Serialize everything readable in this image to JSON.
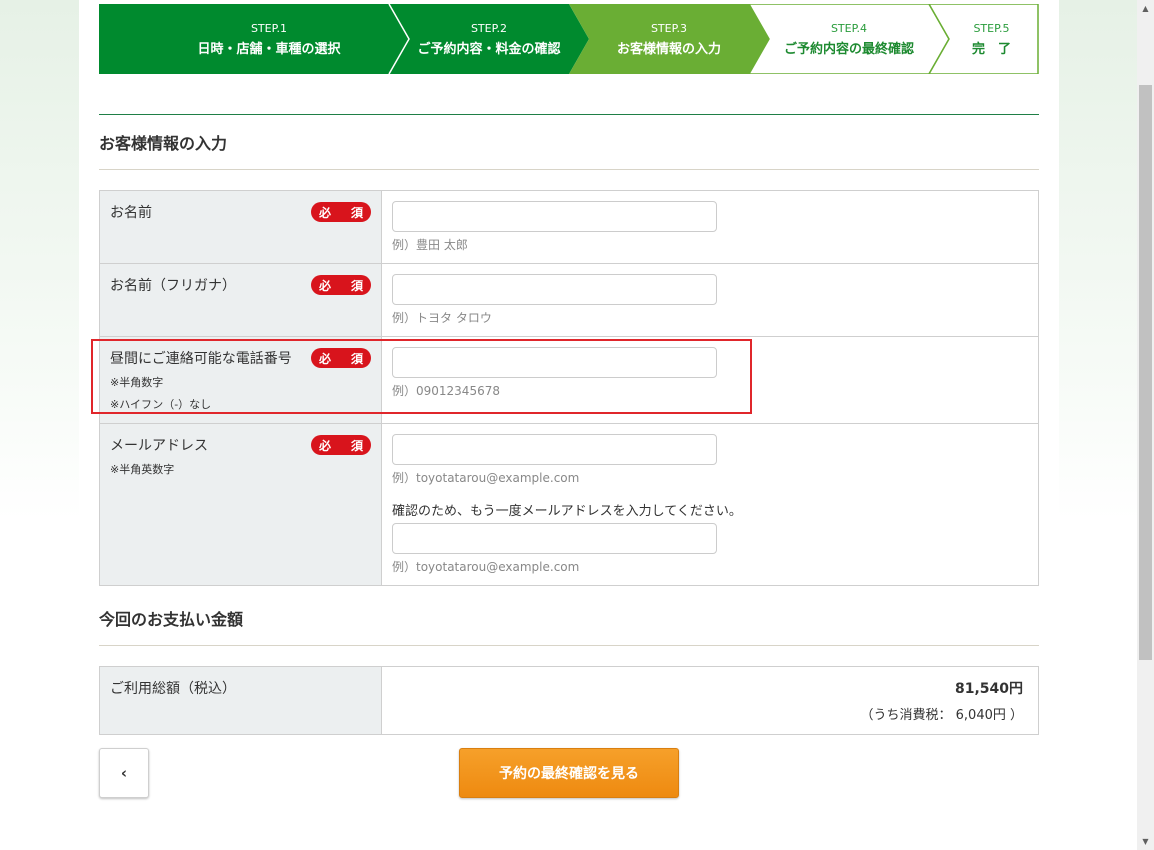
{
  "steps": [
    {
      "num": "STEP.1",
      "name": "日時・店舗・車種の選択"
    },
    {
      "num": "STEP.2",
      "name": "ご予約内容・料金の確認"
    },
    {
      "num": "STEP.3",
      "name": "お客様情報の入力"
    },
    {
      "num": "STEP.4",
      "name": "ご予約内容の最終確認"
    },
    {
      "num": "STEP.5",
      "name": "完　了"
    }
  ],
  "colors": {
    "step_done": "#008a2e",
    "step_current": "#6aae34",
    "required_badge": "#d8141c",
    "primary_button": "#f29419"
  },
  "customer_section": {
    "title": "お客様情報の入力",
    "required_label": "必　須",
    "fields": {
      "name": {
        "label": "お名前",
        "value": "",
        "hint": "例）豊田 太郎"
      },
      "kana": {
        "label": "お名前（フリガナ）",
        "value": "",
        "hint": "例）トヨタ タロウ"
      },
      "phone": {
        "label": "昼間にご連絡可能な電話番号",
        "note1": "※半角数字",
        "note2": "※ハイフン（-）なし",
        "value": "",
        "hint": "例）09012345678"
      },
      "email": {
        "label": "メールアドレス",
        "note1": "※半角英数字",
        "value": "",
        "hint": "例）toyotatarou@example.com",
        "confirm_note": "確認のため、もう一度メールアドレスを入力してください。",
        "confirm_value": "",
        "confirm_hint": "例）toyotatarou@example.com"
      }
    }
  },
  "payment_section": {
    "title": "今回のお支払い金額",
    "total_label": "ご利用総額（税込）",
    "total_value": "81,540円",
    "tax_note": "（うち消費税： 6,040円 ）"
  },
  "buttons": {
    "back": "‹",
    "next": "予約の最終確認を見る"
  },
  "scrollbar": {
    "up": "▲",
    "down": "▼"
  }
}
